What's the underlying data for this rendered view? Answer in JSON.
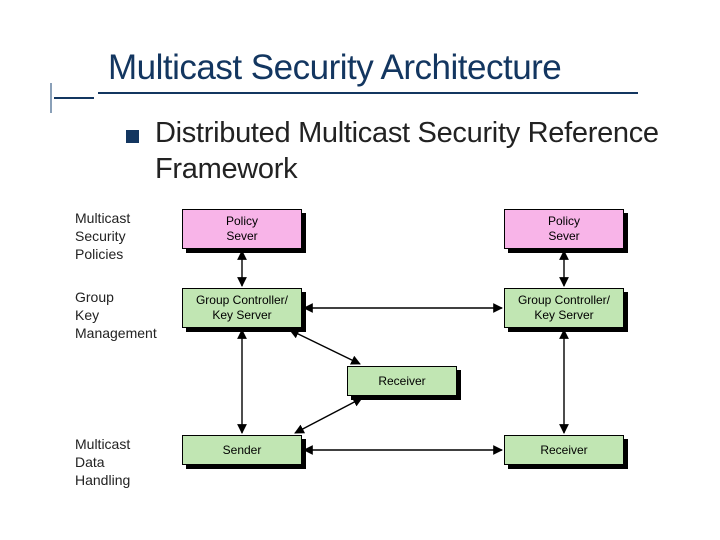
{
  "title": "Multicast Security Architecture",
  "subtitle": "Distributed Multicast Security Reference Framework",
  "rows": {
    "policies": "Multicast\nSecurity\nPolicies",
    "keymgmt": "Group\nKey\nManagement",
    "datahandling": "Multicast\nData\nHandling"
  },
  "boxes": {
    "policy_left": "Policy\nSever",
    "policy_right": "Policy\nSever",
    "gc_left": "Group Controller/\nKey Server",
    "gc_right": "Group Controller/\nKey Server",
    "receiver_mid": "Receiver",
    "sender": "Sender",
    "receiver_right": "Receiver"
  }
}
